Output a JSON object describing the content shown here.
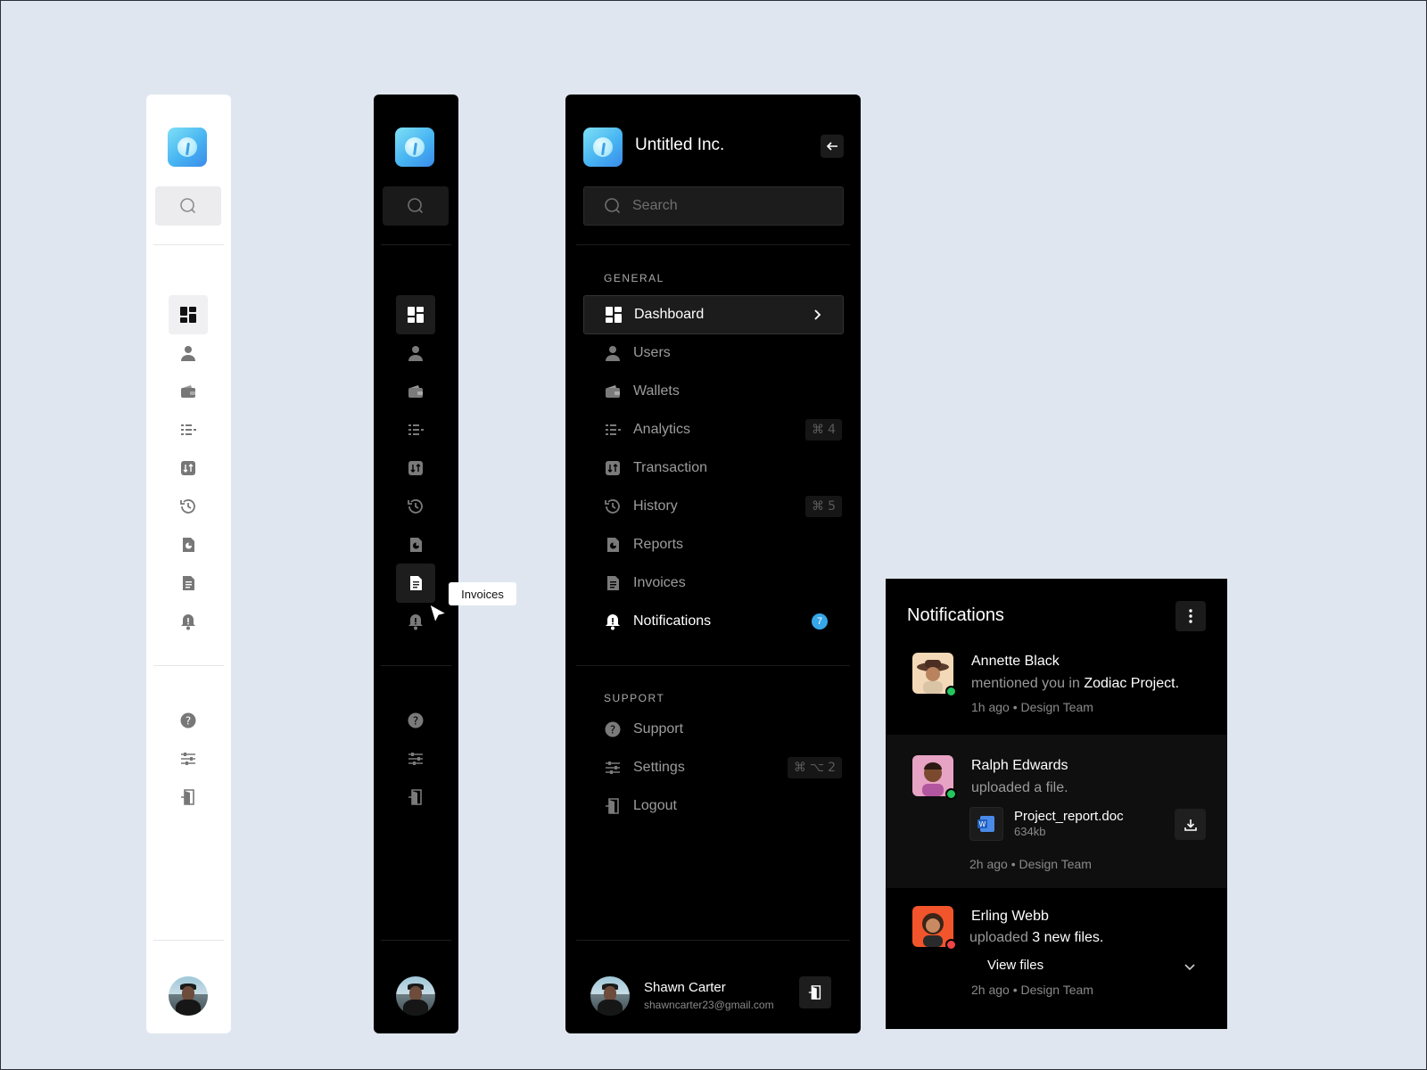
{
  "brand": {
    "name": "Untitled Inc."
  },
  "search": {
    "placeholder": "Search"
  },
  "tooltip": {
    "label": "Invoices"
  },
  "sidebar": {
    "general_label": "GENERAL",
    "support_label": "SUPPORT",
    "items": [
      {
        "label": "Dashboard",
        "icon": "dashboard-icon"
      },
      {
        "label": "Users",
        "icon": "user-icon"
      },
      {
        "label": "Wallets",
        "icon": "wallet-icon"
      },
      {
        "label": "Analytics",
        "icon": "analytics-icon",
        "shortcut": "4"
      },
      {
        "label": "Transaction",
        "icon": "transaction-icon"
      },
      {
        "label": "History",
        "icon": "history-icon",
        "shortcut": "5"
      },
      {
        "label": "Reports",
        "icon": "reports-icon"
      },
      {
        "label": "Invoices",
        "icon": "invoice-icon"
      },
      {
        "label": "Notifications",
        "icon": "bell-icon",
        "badge": "7"
      }
    ],
    "support_items": [
      {
        "label": "Support",
        "icon": "help-icon"
      },
      {
        "label": "Settings",
        "icon": "sliders-icon",
        "shortcut": "2"
      },
      {
        "label": "Logout",
        "icon": "logout-icon"
      }
    ],
    "shortcut_cmd": "⌘",
    "shortcut_opt": "⌥"
  },
  "user": {
    "name": "Shawn Carter",
    "email": "shawncarter23@gmail.com"
  },
  "notifications": {
    "title": "Notifications",
    "items": [
      {
        "name": "Annette Black",
        "msg": "mentioned you in",
        "highlight": "Zodiac Project.",
        "time": "1h ago",
        "team": "Design Team",
        "status": "online"
      },
      {
        "name": "Ralph Edwards",
        "msg": "uploaded a file.",
        "file_name": "Project_report.doc",
        "file_size": "634kb",
        "time": "2h ago",
        "team": "Design Team",
        "status": "online"
      },
      {
        "name": "Erling Webb",
        "msg": "uploaded",
        "highlight": "3 new files.",
        "view_label": "View files",
        "time": "2h ago",
        "team": "Design Team",
        "status": "busy"
      }
    ],
    "separator": "•"
  },
  "colors": {
    "accent": "#36a6e8",
    "online": "#22c55e",
    "busy": "#ef4444",
    "background": "#dfe6f0"
  }
}
